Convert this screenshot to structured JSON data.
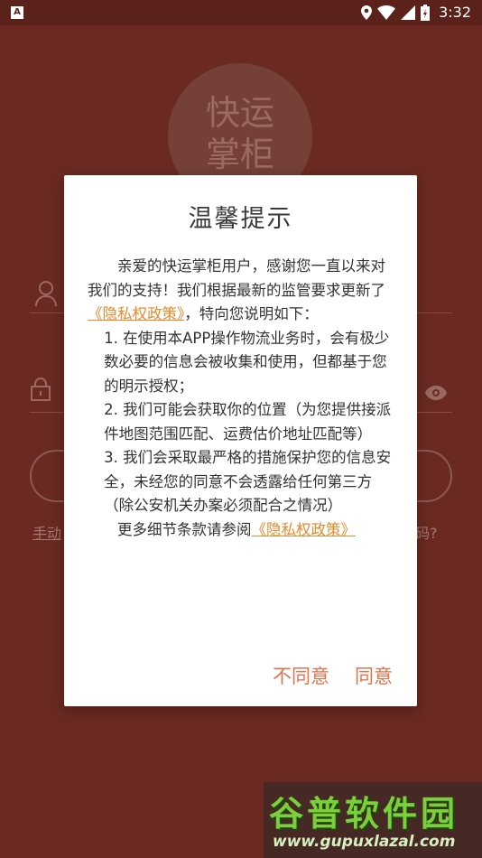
{
  "status_bar": {
    "app_icon_letter": "A",
    "time": "3:32",
    "icons": [
      "location-icon",
      "wifi-icon",
      "signal-icon",
      "battery-icon"
    ]
  },
  "background": {
    "logo_text": "快运\n掌柜",
    "manual_link": "手动",
    "forgot_link": "码?"
  },
  "dialog": {
    "title": "温馨提示",
    "intro_prefix": "亲爱的快运掌柜用户，感谢您一直以来对我们的支持！我们根据最新的监管要求更新了",
    "policy_link": "《隐私权政策》",
    "intro_suffix": "，特向您说明如下：",
    "items": [
      "1. 在使用本APP操作物流业务时，会有极少数必要的信息会被收集和使用，但都基于您的明示授权；",
      "2. 我们可能会获取你的位置（为您提供接派件地图范围匹配、运费估价地址匹配等）",
      "3. 我们会采取最严格的措施保护您的信息安全，未经您的同意不会透露给任何第三方（除公安机关办案必须配合之情况）"
    ],
    "more_prefix": "更多细节条款请参阅",
    "more_link": "《隐私权政策》",
    "disagree_label": "不同意",
    "agree_label": "同意"
  },
  "watermark": {
    "title": "谷普软件园",
    "url": "www.gupuxlazal.com"
  },
  "colors": {
    "backdrop": "#6a2a22",
    "link": "#e8892b",
    "action": "#e3714e"
  }
}
